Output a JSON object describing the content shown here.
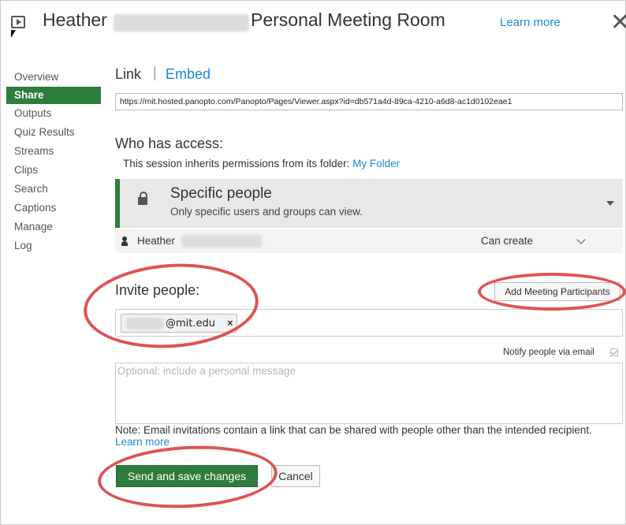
{
  "header": {
    "title_first": "Heather",
    "title_rest": "Personal Meeting Room",
    "learn_more": "Learn more",
    "close_glyph": "✕"
  },
  "sidebar": {
    "items": [
      {
        "label": "Overview"
      },
      {
        "label": "Share",
        "active": true
      },
      {
        "label": "Outputs"
      },
      {
        "label": "Quiz Results"
      },
      {
        "label": "Streams"
      },
      {
        "label": "Clips"
      },
      {
        "label": "Search"
      },
      {
        "label": "Captions"
      },
      {
        "label": "Manage"
      },
      {
        "label": "Log"
      }
    ]
  },
  "share": {
    "link_tab": "Link",
    "separator": "|",
    "embed_tab": "Embed",
    "url": "https://mit.hosted.panopto.com/Panopto/Pages/Viewer.aspx?id=db571a4d-89ca-4210-a6d8-ac1d0102eae1",
    "who_has_access": "Who has access:",
    "inherit_text": "This session inherits permissions from its folder:",
    "inherit_link": "My Folder",
    "access_level": {
      "title": "Specific people",
      "subtitle": "Only specific users and groups can view."
    },
    "user_row": {
      "name": "Heather",
      "role": "Can create"
    },
    "invite_title": "Invite people:",
    "add_participants": "Add Meeting Participants",
    "invitee_chip": "@mit.edu",
    "chip_remove": "×",
    "notify_label": "Notify people via email",
    "notify_checked": true,
    "message_placeholder": "Optional: include a personal message",
    "note_text": "Note: Email invitations contain a link that can be shared with people other than the intended recipient.",
    "note_link": "Learn more",
    "send_button": "Send and save changes",
    "cancel_button": "Cancel"
  },
  "colors": {
    "accent_green": "#2e7d3c",
    "link_blue": "#1a8ad6",
    "annotation_red": "#e05252"
  }
}
